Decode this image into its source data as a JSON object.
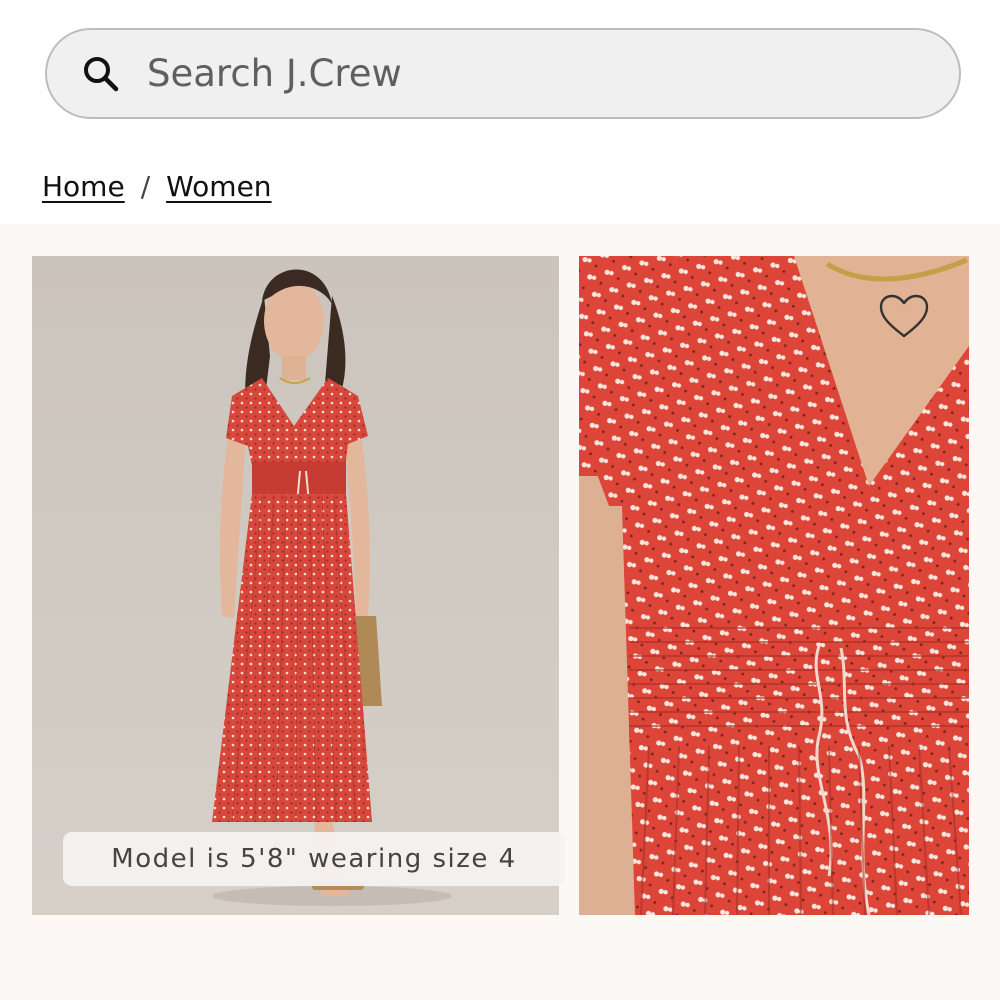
{
  "search": {
    "placeholder": "Search J.Crew",
    "value": "",
    "icon": "search-icon"
  },
  "breadcrumb": {
    "items": [
      {
        "label": "Home"
      },
      {
        "label": "Women"
      }
    ],
    "separator": "/"
  },
  "gallery": {
    "images": [
      {
        "alt": "Model in red printed pleated midi dress",
        "caption": "Model is 5'8\" wearing size 4"
      },
      {
        "alt": "Close-up of dress V-neck and smocked waist"
      }
    ],
    "wishlist_icon": "heart-outline-icon"
  },
  "colors": {
    "dress_red": "#d8473c",
    "background": "#fbf8f5",
    "search_bg": "#f0f0f0"
  }
}
